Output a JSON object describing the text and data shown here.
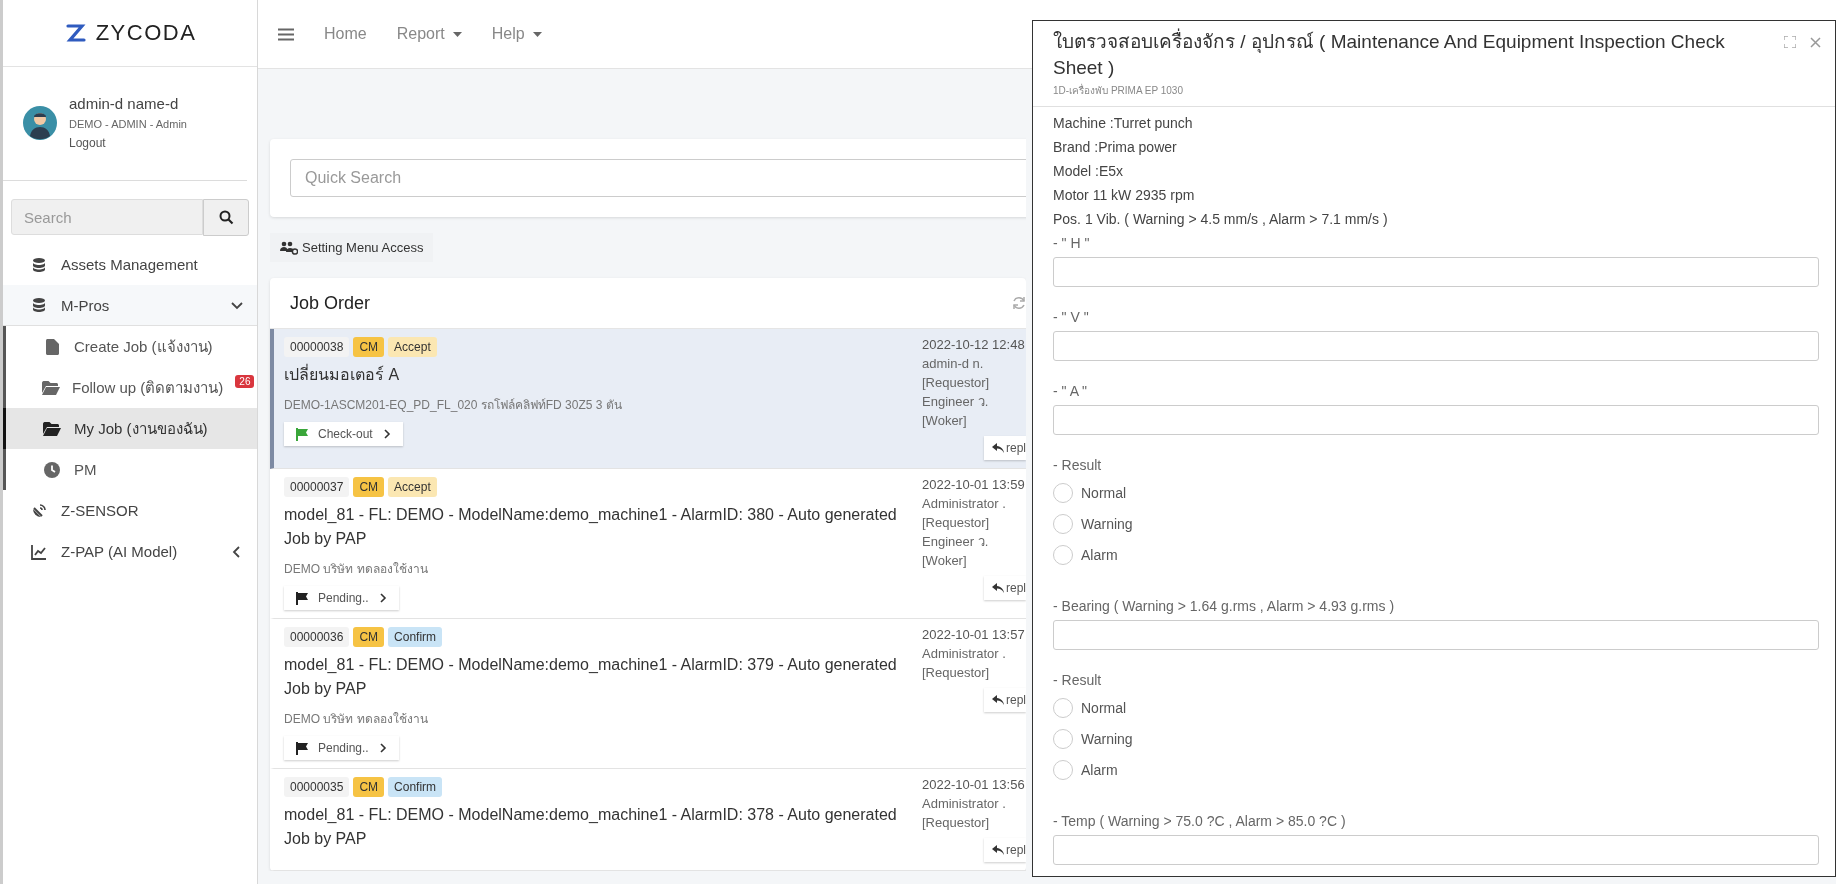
{
  "brand": {
    "name": "ZYCODA"
  },
  "user": {
    "name": "admin-d name-d",
    "role": "DEMO - ADMIN - Admin",
    "logout": "Logout"
  },
  "sidebar": {
    "search": {
      "placeholder": "Search"
    },
    "items": [
      {
        "label": "Assets Management",
        "selected": false
      },
      {
        "label": "M-Pros",
        "selected": false,
        "expanded": true,
        "children": [
          {
            "label": "Create Job (แจ้งงาน)",
            "selected": false
          },
          {
            "label": "Follow up (ติดตามงาน)",
            "selected": false,
            "badge": "26"
          },
          {
            "label": "My Job (งานของฉัน)",
            "selected": true
          },
          {
            "label": "PM",
            "selected": false
          }
        ]
      },
      {
        "label": "Z-SENSOR",
        "selected": false
      },
      {
        "label": "Z-PAP (AI Model)",
        "selected": false,
        "expanded": false
      }
    ]
  },
  "navbar": {
    "items": [
      {
        "label": "Home",
        "dropdown": false
      },
      {
        "label": "Report",
        "dropdown": true
      },
      {
        "label": "Help",
        "dropdown": true
      }
    ]
  },
  "quick_search": {
    "placeholder": "Quick Search"
  },
  "setting_button": "Setting Menu Access",
  "job_order": {
    "title": "Job Order",
    "rows": [
      {
        "id": "00000038",
        "type": "CM",
        "status": {
          "text": "Accept",
          "color": "#fbe7b2"
        },
        "title": "เปลี่ยนมอเตอร์ A",
        "detail": "DEMO-1ASCM201-EQ_PD_FL_020 รถโฟล์คลิฟท์FD 30Z5 3 ตัน",
        "action": {
          "label": "Check-out",
          "color": "#3aa63a"
        },
        "date": "2022-10-12 12:48",
        "people": [
          "admin-d n.",
          "[Requestor]",
          "Engineer ว.",
          "[Woker]"
        ],
        "reply": "repl",
        "selected": true
      },
      {
        "id": "00000037",
        "type": "CM",
        "status": {
          "text": "Accept",
          "color": "#fbe7b2"
        },
        "title": "model_81 - FL: DEMO - ModelName:demo_machine1 - AlarmID: 380 - Auto generated Job by PAP",
        "detail": "DEMO บริษัท ทดลองใช้งาน",
        "action": {
          "label": "Pending..",
          "color": "#222222"
        },
        "date": "2022-10-01 13:59",
        "people": [
          "Administrator .",
          "[Requestor]",
          "Engineer ว.",
          "[Woker]"
        ],
        "reply": "repl",
        "selected": false
      },
      {
        "id": "00000036",
        "type": "CM",
        "status": {
          "text": "Confirm",
          "color": "#c9e4f6"
        },
        "title": "model_81 - FL: DEMO - ModelName:demo_machine1 - AlarmID: 379 - Auto generated Job by PAP",
        "detail": "DEMO บริษัท ทดลองใช้งาน",
        "action": {
          "label": "Pending..",
          "color": "#222222"
        },
        "date": "2022-10-01 13:57",
        "people": [
          "Administrator .",
          "[Requestor]"
        ],
        "reply": "repl",
        "selected": false
      },
      {
        "id": "00000035",
        "type": "CM",
        "status": {
          "text": "Confirm",
          "color": "#c9e4f6"
        },
        "title": "model_81 - FL: DEMO - ModelName:demo_machine1 - AlarmID: 378 - Auto generated Job by PAP",
        "date": "2022-10-01 13:56",
        "people": [
          "Administrator .",
          "[Requestor]"
        ],
        "reply": "repl",
        "selected": false
      }
    ]
  },
  "modal": {
    "title": "ใบตรวจสอบเครื่องจักร / อุปกรณ์ ( Maintenance And Equipment Inspection Check Sheet )",
    "subtitle": "1D-เครื่องพับ PRIMA EP 1030",
    "info": [
      "Machine :Turret punch",
      "Brand :Prima power",
      "Model :E5x",
      "Motor 11 kW 2935 rpm",
      "Pos. 1 Vib. ( Warning > 4.5 mm/s , Alarm > 7.1 mm/s )"
    ],
    "fields": [
      {
        "kind": "text",
        "label": "- \" H \""
      },
      {
        "kind": "text",
        "label": "- \" V \""
      },
      {
        "kind": "text",
        "label": "- \" A \""
      },
      {
        "kind": "radio",
        "label": "- Result",
        "options": [
          {
            "label": "Normal",
            "selected": false
          },
          {
            "label": "Warning",
            "selected": false
          },
          {
            "label": "Alarm",
            "selected": false
          }
        ]
      },
      {
        "kind": "text",
        "label": "- Bearing ( Warning > 1.64 g.rms , Alarm > 4.93 g.rms )"
      },
      {
        "kind": "radio",
        "label": "- Result",
        "options": [
          {
            "label": "Normal",
            "selected": false
          },
          {
            "label": "Warning",
            "selected": false
          },
          {
            "label": "Alarm",
            "selected": false
          }
        ]
      },
      {
        "kind": "text",
        "label": "- Temp ( Warning > 75.0 ?C , Alarm > 85.0 ?C )"
      }
    ]
  }
}
